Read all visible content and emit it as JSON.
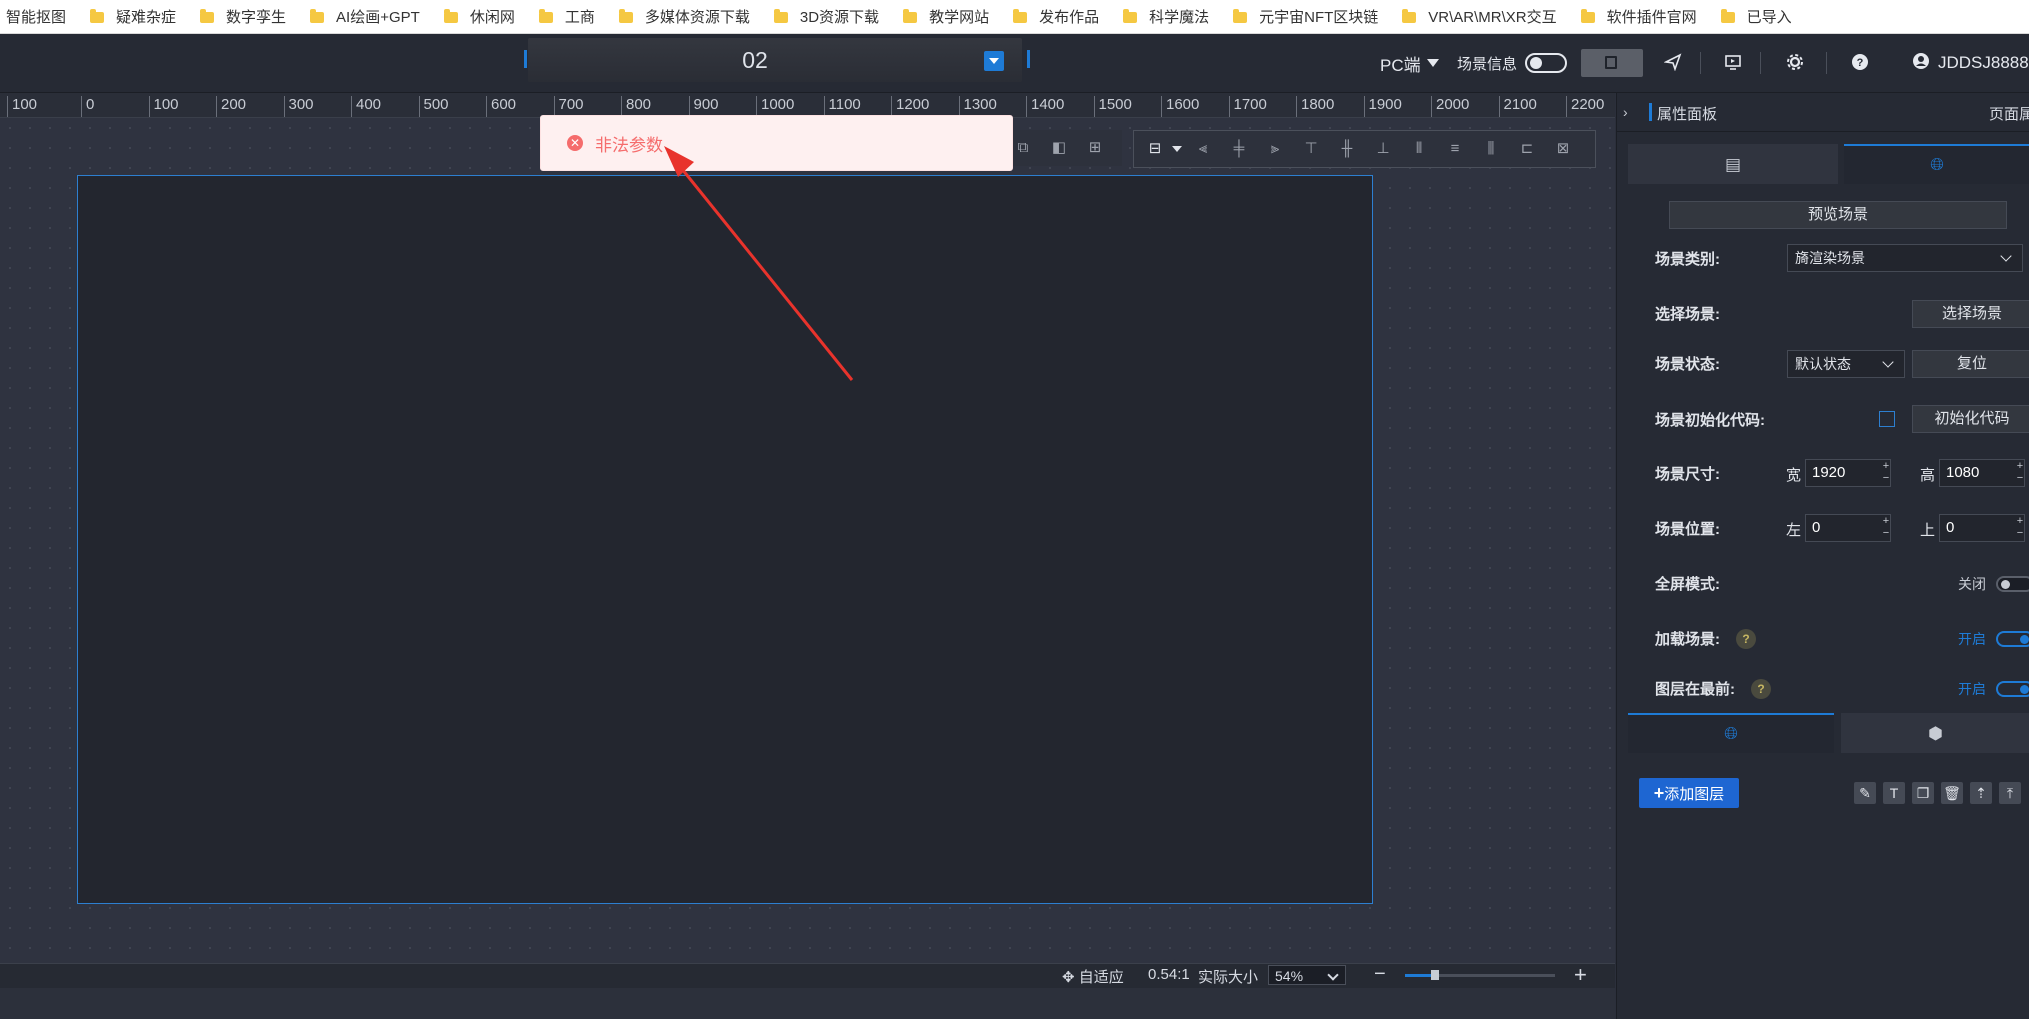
{
  "bookmarks": [
    {
      "label": "智能抠图",
      "folder": false
    },
    {
      "label": "疑难杂症",
      "folder": true
    },
    {
      "label": "数字孪生",
      "folder": true
    },
    {
      "label": "AI绘画+GPT",
      "folder": true
    },
    {
      "label": "休闲网",
      "folder": true
    },
    {
      "label": "工商",
      "folder": true
    },
    {
      "label": "多媒体资源下载",
      "folder": true
    },
    {
      "label": "3D资源下载",
      "folder": true
    },
    {
      "label": "教学网站",
      "folder": true
    },
    {
      "label": "发布作品",
      "folder": true
    },
    {
      "label": "科学魔法",
      "folder": true
    },
    {
      "label": "元宇宙NFT区块链",
      "folder": true
    },
    {
      "label": "VR\\AR\\MR\\XR交互",
      "folder": true
    },
    {
      "label": "软件插件官网",
      "folder": true
    },
    {
      "label": "已导入",
      "folder": true
    }
  ],
  "toolbar": {
    "page_title": "02",
    "device_label": "PC端",
    "scene_info_label": "场景信息",
    "user_name": "JDDSJ8888"
  },
  "ruler": {
    "ticks": [
      "100",
      "0",
      "100",
      "200",
      "300",
      "400",
      "500",
      "600",
      "700",
      "800",
      "900",
      "1000",
      "1100",
      "1200",
      "1300",
      "1400",
      "1500",
      "1600",
      "1700",
      "1800",
      "1900",
      "2000",
      "2100",
      "2200"
    ]
  },
  "toast": {
    "message": "非法参数",
    "type": "error",
    "color": "#f56c6c"
  },
  "statusbar": {
    "fit_label": "自适应",
    "ratio_label": "0.54:1",
    "actual_size_label": "实际大小",
    "zoom_value": "54%",
    "zoom_percent": 54
  },
  "panel": {
    "title": "属性面板",
    "title_right": "页面属",
    "preview_button": "预览场景",
    "scene_type_label": "场景类别:",
    "scene_type_value": "旖渲染场景",
    "select_scene_label": "选择场景:",
    "select_scene_button": "选择场景",
    "scene_state_label": "场景状态:",
    "scene_state_value": "默认状态",
    "reset_button": "复位",
    "init_code_label": "场景初始化代码:",
    "init_code_button": "初始化代码",
    "size_label": "场景尺寸:",
    "width_prefix": "宽",
    "width_value": "1920",
    "height_prefix": "高",
    "height_value": "1080",
    "position_label": "场景位置:",
    "left_prefix": "左",
    "left_value": "0",
    "top_prefix": "上",
    "top_value": "0",
    "fullscreen_label": "全屏模式:",
    "fullscreen_state": "关闭",
    "load_scene_label": "加载场景:",
    "load_scene_state": "开启",
    "layer_front_label": "图层在最前:",
    "layer_front_state": "开启",
    "add_layer_button": "添加图层"
  },
  "colors": {
    "accent": "#1e7bd6",
    "error": "#f56c6c",
    "arrow": "#e8332c"
  }
}
